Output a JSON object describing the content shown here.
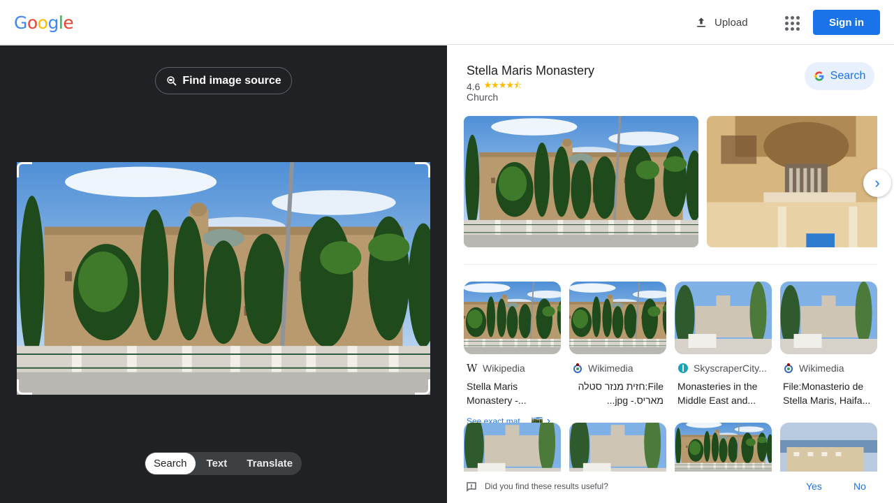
{
  "header": {
    "logo": [
      "G",
      "o",
      "o",
      "g",
      "l",
      "e"
    ],
    "logo_colors": [
      "#4285F4",
      "#EA4335",
      "#FBBC05",
      "#4285F4",
      "#34A853",
      "#EA4335"
    ],
    "upload_label": "Upload",
    "signin_label": "Sign in"
  },
  "left": {
    "find_source_label": "Find image source",
    "modes": [
      "Search",
      "Text",
      "Translate"
    ],
    "active_mode": "Search"
  },
  "knowledge_panel": {
    "title": "Stella Maris Monastery",
    "rating": "4.6",
    "rating_stars": 4.6,
    "type": "Church",
    "search_label": "Search"
  },
  "matches": [
    {
      "source": "Wikipedia",
      "title": "Stella Maris Monastery -...",
      "rtl": false,
      "icon": "wikipedia-icon"
    },
    {
      "source": "Wikimedia",
      "title": "File:חזית מנזר סטלה מאריס.- jpg...",
      "rtl": true,
      "icon": "wikimedia-icon"
    },
    {
      "source": "SkyscraperCity...",
      "title": "Monasteries in the Middle East and...",
      "rtl": false,
      "icon": "skyscrapercity-icon"
    },
    {
      "source": "Wikimedia",
      "title": "File:Monasterio de Stella Maris, Haifa...",
      "rtl": false,
      "icon": "wikimedia-icon"
    }
  ],
  "see_exact_label": "See exact mat...",
  "feedback": {
    "question": "Did you find these results useful?",
    "yes": "Yes",
    "no": "No"
  },
  "colors": {
    "accent": "#1a73e8",
    "left_bg": "#202124",
    "star": "#fbbc04"
  }
}
